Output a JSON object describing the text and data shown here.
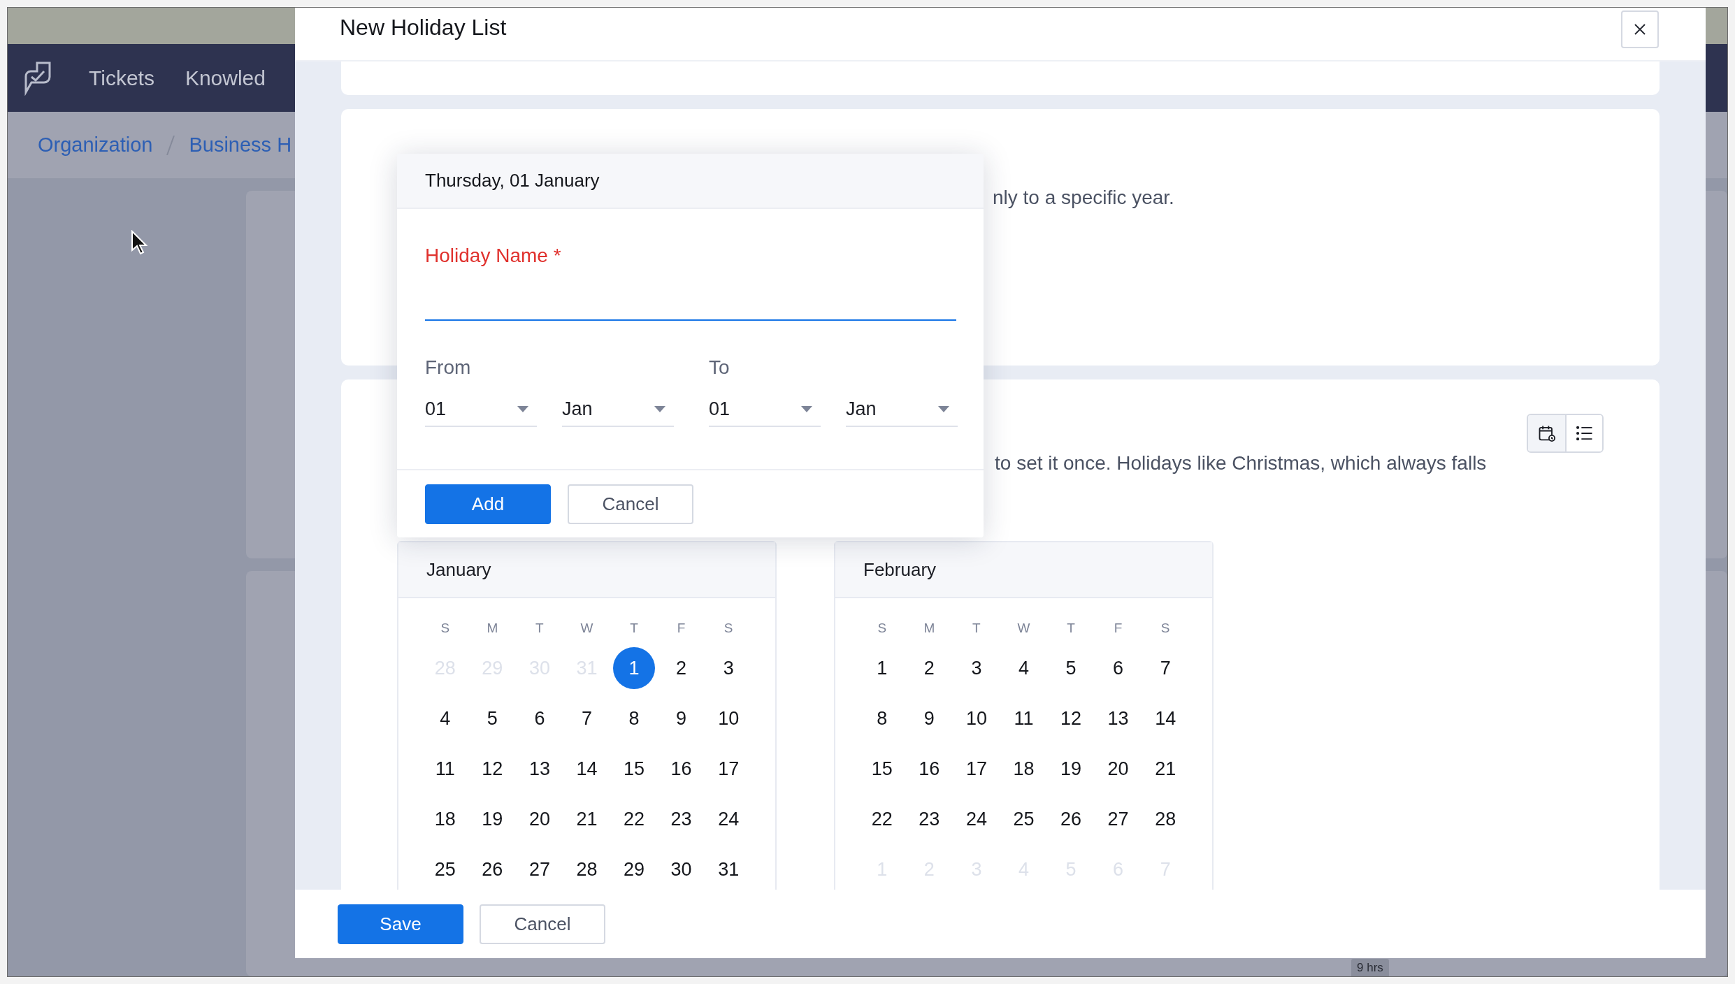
{
  "app_nav": {
    "tabs": [
      "Tickets",
      "Knowled"
    ]
  },
  "breadcrumb": [
    "Organization",
    "Business H"
  ],
  "background_chip": "9 hrs",
  "modal": {
    "title": "New Holiday List"
  },
  "occurrence_section": {
    "description": "nly to a specific year."
  },
  "calendar_section": {
    "description": "to set it once. Holidays like Christmas, which always falls",
    "view_toggle": [
      {
        "kind": "calendar",
        "selected": true
      },
      {
        "kind": "list",
        "selected": false
      }
    ],
    "months": [
      {
        "name": "January",
        "weekdays": [
          "S",
          "M",
          "T",
          "W",
          "T",
          "F",
          "S"
        ],
        "days": [
          {
            "label": "28",
            "outside": true,
            "selected": false
          },
          {
            "label": "29",
            "outside": true,
            "selected": false
          },
          {
            "label": "30",
            "outside": true,
            "selected": false
          },
          {
            "label": "31",
            "outside": true,
            "selected": false
          },
          {
            "label": "1",
            "outside": false,
            "selected": true
          },
          {
            "label": "2",
            "outside": false,
            "selected": false
          },
          {
            "label": "3",
            "outside": false,
            "selected": false
          },
          {
            "label": "4",
            "outside": false,
            "selected": false
          },
          {
            "label": "5",
            "outside": false,
            "selected": false
          },
          {
            "label": "6",
            "outside": false,
            "selected": false
          },
          {
            "label": "7",
            "outside": false,
            "selected": false
          },
          {
            "label": "8",
            "outside": false,
            "selected": false
          },
          {
            "label": "9",
            "outside": false,
            "selected": false
          },
          {
            "label": "10",
            "outside": false,
            "selected": false
          },
          {
            "label": "11",
            "outside": false,
            "selected": false
          },
          {
            "label": "12",
            "outside": false,
            "selected": false
          },
          {
            "label": "13",
            "outside": false,
            "selected": false
          },
          {
            "label": "14",
            "outside": false,
            "selected": false
          },
          {
            "label": "15",
            "outside": false,
            "selected": false
          },
          {
            "label": "16",
            "outside": false,
            "selected": false
          },
          {
            "label": "17",
            "outside": false,
            "selected": false
          },
          {
            "label": "18",
            "outside": false,
            "selected": false
          },
          {
            "label": "19",
            "outside": false,
            "selected": false
          },
          {
            "label": "20",
            "outside": false,
            "selected": false
          },
          {
            "label": "21",
            "outside": false,
            "selected": false
          },
          {
            "label": "22",
            "outside": false,
            "selected": false
          },
          {
            "label": "23",
            "outside": false,
            "selected": false
          },
          {
            "label": "24",
            "outside": false,
            "selected": false
          },
          {
            "label": "25",
            "outside": false,
            "selected": false
          },
          {
            "label": "26",
            "outside": false,
            "selected": false
          },
          {
            "label": "27",
            "outside": false,
            "selected": false
          },
          {
            "label": "28",
            "outside": false,
            "selected": false
          },
          {
            "label": "29",
            "outside": false,
            "selected": false
          },
          {
            "label": "30",
            "outside": false,
            "selected": false
          },
          {
            "label": "31",
            "outside": false,
            "selected": false
          }
        ]
      },
      {
        "name": "February",
        "weekdays": [
          "S",
          "M",
          "T",
          "W",
          "T",
          "F",
          "S"
        ],
        "days": [
          {
            "label": "1",
            "outside": false,
            "selected": false
          },
          {
            "label": "2",
            "outside": false,
            "selected": false
          },
          {
            "label": "3",
            "outside": false,
            "selected": false
          },
          {
            "label": "4",
            "outside": false,
            "selected": false
          },
          {
            "label": "5",
            "outside": false,
            "selected": false
          },
          {
            "label": "6",
            "outside": false,
            "selected": false
          },
          {
            "label": "7",
            "outside": false,
            "selected": false
          },
          {
            "label": "8",
            "outside": false,
            "selected": false
          },
          {
            "label": "9",
            "outside": false,
            "selected": false
          },
          {
            "label": "10",
            "outside": false,
            "selected": false
          },
          {
            "label": "11",
            "outside": false,
            "selected": false
          },
          {
            "label": "12",
            "outside": false,
            "selected": false
          },
          {
            "label": "13",
            "outside": false,
            "selected": false
          },
          {
            "label": "14",
            "outside": false,
            "selected": false
          },
          {
            "label": "15",
            "outside": false,
            "selected": false
          },
          {
            "label": "16",
            "outside": false,
            "selected": false
          },
          {
            "label": "17",
            "outside": false,
            "selected": false
          },
          {
            "label": "18",
            "outside": false,
            "selected": false
          },
          {
            "label": "19",
            "outside": false,
            "selected": false
          },
          {
            "label": "20",
            "outside": false,
            "selected": false
          },
          {
            "label": "21",
            "outside": false,
            "selected": false
          },
          {
            "label": "22",
            "outside": false,
            "selected": false
          },
          {
            "label": "23",
            "outside": false,
            "selected": false
          },
          {
            "label": "24",
            "outside": false,
            "selected": false
          },
          {
            "label": "25",
            "outside": false,
            "selected": false
          },
          {
            "label": "26",
            "outside": false,
            "selected": false
          },
          {
            "label": "27",
            "outside": false,
            "selected": false
          },
          {
            "label": "28",
            "outside": false,
            "selected": false
          },
          {
            "label": "1",
            "outside": true,
            "selected": false
          },
          {
            "label": "2",
            "outside": true,
            "selected": false
          },
          {
            "label": "3",
            "outside": true,
            "selected": false
          },
          {
            "label": "4",
            "outside": true,
            "selected": false
          },
          {
            "label": "5",
            "outside": true,
            "selected": false
          },
          {
            "label": "6",
            "outside": true,
            "selected": false
          },
          {
            "label": "7",
            "outside": true,
            "selected": false
          }
        ]
      }
    ]
  },
  "holiday_popup": {
    "date_heading": "Thursday, 01 January",
    "name_field": {
      "label": "Holiday Name",
      "required_mark": "*"
    },
    "range": [
      {
        "label": "From",
        "day": "01",
        "month": "Jan"
      },
      {
        "label": "To",
        "day": "01",
        "month": "Jan"
      }
    ],
    "buttons": [
      {
        "label": "Add",
        "kind": "primary"
      },
      {
        "label": "Cancel",
        "kind": "secondary"
      }
    ]
  },
  "footer_buttons": [
    {
      "label": "Save",
      "kind": "primary"
    },
    {
      "label": "Cancel",
      "kind": "secondary"
    }
  ]
}
